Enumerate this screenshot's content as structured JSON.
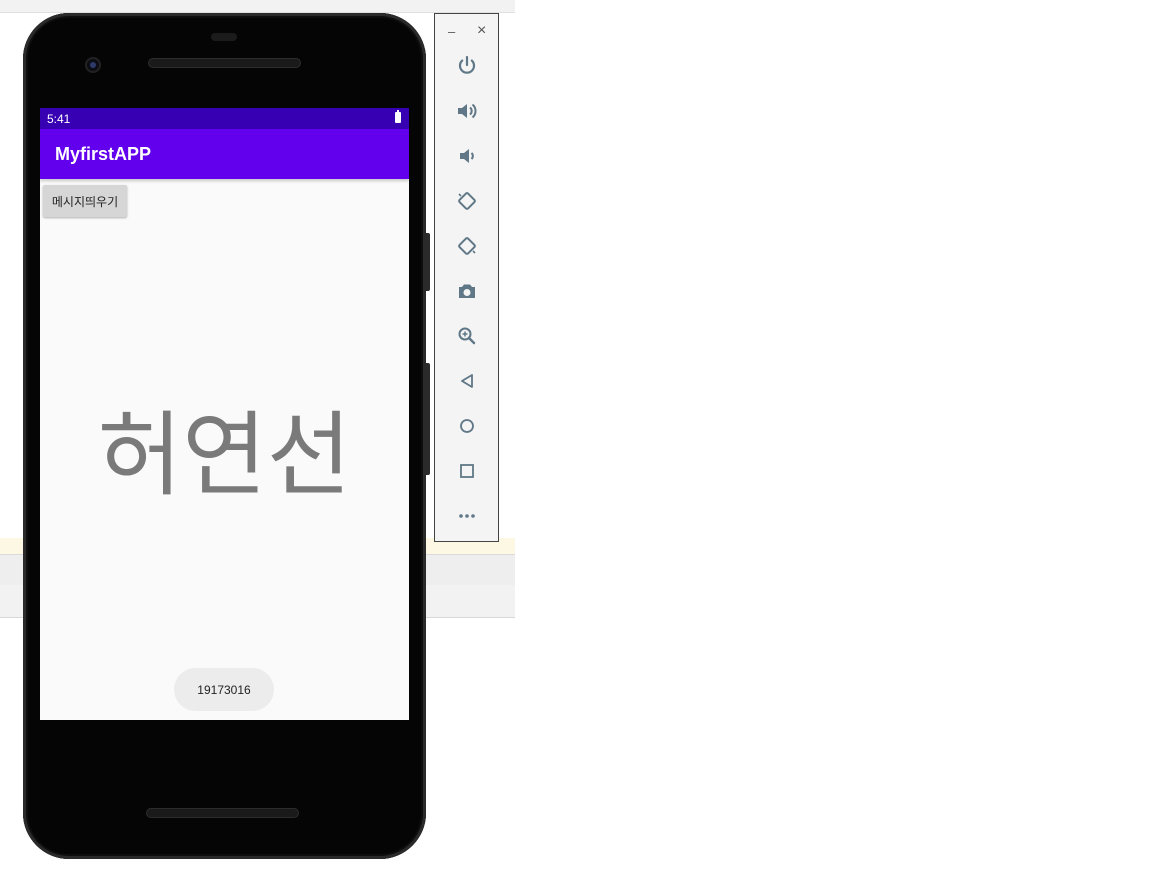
{
  "phone": {
    "status_time": "5:41",
    "app_title": "MyfirstAPP",
    "button_label": "메시지띄우기",
    "center_text": "허연선",
    "toast_text": "19173016"
  },
  "toolbar": {
    "minimize_glyph": "–",
    "close_glyph": "×",
    "icons": [
      "power-icon",
      "volume-up-icon",
      "volume-down-icon",
      "rotate-left-icon",
      "rotate-right-icon",
      "camera-icon",
      "zoom-icon",
      "back-icon",
      "home-icon",
      "overview-icon",
      "more-icon"
    ]
  },
  "colors": {
    "status_bar": "#3700b3",
    "app_bar": "#6200ee",
    "toolbar_icon": "#5f7786"
  }
}
